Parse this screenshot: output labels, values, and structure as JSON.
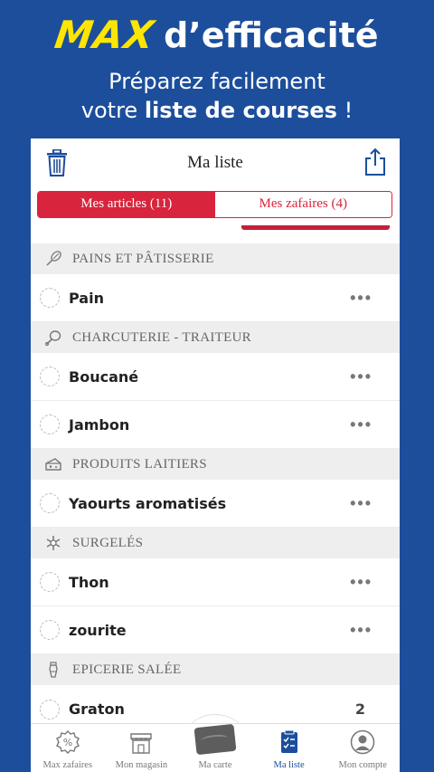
{
  "promo": {
    "brand": "MAX",
    "tagline": "d’efficacité",
    "line1": "Préparez facilement",
    "line2_prefix": "votre ",
    "line2_bold": "liste de courses",
    "line2_suffix": " !"
  },
  "header": {
    "title": "Ma liste",
    "left_icon": "trash-icon",
    "right_icon": "share-icon"
  },
  "tabs": [
    {
      "label": "Mes articles (11)",
      "active": true
    },
    {
      "label": "Mes zafaires (4)",
      "active": false
    }
  ],
  "categories": [
    {
      "label": "PAINS ET PÂTISSERIE",
      "icon": "whisk-icon",
      "items": [
        {
          "name": "Pain",
          "action": "•••"
        }
      ]
    },
    {
      "label": "CHARCUTERIE - TRAITEUR",
      "icon": "drumstick-icon",
      "items": [
        {
          "name": "Boucané",
          "action": "•••"
        },
        {
          "name": "Jambon",
          "action": "•••"
        }
      ]
    },
    {
      "label": "PRODUITS LAITIERS",
      "icon": "cheese-icon",
      "items": [
        {
          "name": "Yaourts aromatisés",
          "action": "•••"
        }
      ]
    },
    {
      "label": "SURGELÉS",
      "icon": "snowflake-icon",
      "items": [
        {
          "name": "Thon",
          "action": "•••"
        },
        {
          "name": "zourite",
          "action": "•••"
        }
      ]
    },
    {
      "label": "EPICERIE SALÉE",
      "icon": "salt-shaker-icon",
      "items": [
        {
          "name": "Graton",
          "action": "2"
        }
      ]
    }
  ],
  "bottom_nav": [
    {
      "label": "Max zafaires",
      "icon": "percent-badge-icon",
      "active": false
    },
    {
      "label": "Mon magasin",
      "icon": "store-icon",
      "active": false
    },
    {
      "label": "Ma carte",
      "icon": "loyalty-card-icon",
      "active": false
    },
    {
      "label": "Ma liste",
      "icon": "checklist-icon",
      "active": true
    },
    {
      "label": "Mon compte",
      "icon": "user-icon",
      "active": false
    }
  ],
  "colors": {
    "background": "#1c4e9c",
    "brand_yellow": "#ffe600",
    "accent_red": "#d8243c",
    "active_nav": "#1c4e9c"
  }
}
